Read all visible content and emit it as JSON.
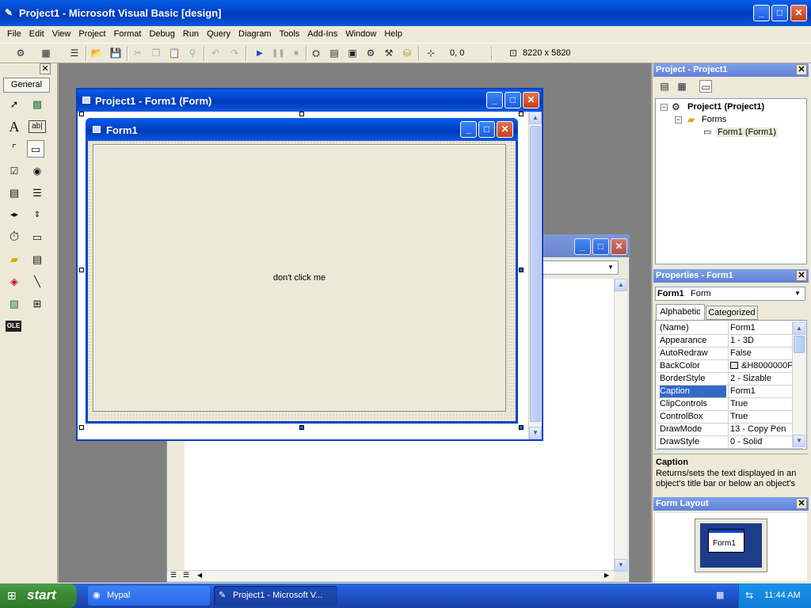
{
  "app": {
    "title": "Project1 - Microsoft Visual Basic [design]"
  },
  "menu": [
    "File",
    "Edit",
    "View",
    "Project",
    "Format",
    "Debug",
    "Run",
    "Query",
    "Diagram",
    "Tools",
    "Add-Ins",
    "Window",
    "Help"
  ],
  "toolbar": {
    "position": "0, 0",
    "size": "8220 x 5820",
    "icons": [
      "add-project-icon",
      "add-form-icon",
      "menu-editor-icon",
      "open-icon",
      "save-icon",
      "cut-icon",
      "copy-icon",
      "paste-icon",
      "find-icon",
      "undo-icon",
      "redo-icon",
      "start-icon",
      "break-icon",
      "end-icon",
      "project-explorer-icon",
      "properties-icon",
      "form-layout-icon",
      "object-browser-icon",
      "toolbox-icon",
      "data-view-icon",
      "component-icon"
    ]
  },
  "toolbox": {
    "tab": "General",
    "tools": [
      "pointer-icon",
      "picturebox-icon",
      "label-icon",
      "textbox-icon",
      "frame-icon",
      "commandbutton-icon",
      "checkbox-icon",
      "optionbutton-icon",
      "combobox-icon",
      "listbox-icon",
      "hscrollbar-icon",
      "vscrollbar-icon",
      "timer-icon",
      "drivelistbox-icon",
      "dirlistbox-icon",
      "filelistbox-icon",
      "shape-icon",
      "line-icon",
      "image-icon",
      "data-icon",
      "ole-icon"
    ]
  },
  "form_designer": {
    "window_title": "Project1 - Form1 (Form)",
    "form_caption": "Form1",
    "button_caption": "don't click me"
  },
  "project_explorer": {
    "title": "Project - Project1",
    "root": "Project1 (Project1)",
    "folder": "Forms",
    "item": "Form1 (Form1)"
  },
  "properties": {
    "title": "Properties - Form1",
    "object_name": "Form1",
    "object_type": "Form",
    "tabs": [
      "Alphabetic",
      "Categorized"
    ],
    "rows": [
      {
        "name": "(Name)",
        "value": "Form1"
      },
      {
        "name": "Appearance",
        "value": "1 - 3D"
      },
      {
        "name": "AutoRedraw",
        "value": "False"
      },
      {
        "name": "BackColor",
        "value": "&H8000000F"
      },
      {
        "name": "BorderStyle",
        "value": "2 - Sizable"
      },
      {
        "name": "Caption",
        "value": "Form1"
      },
      {
        "name": "ClipControls",
        "value": "True"
      },
      {
        "name": "ControlBox",
        "value": "True"
      },
      {
        "name": "DrawMode",
        "value": "13 - Copy Pen"
      },
      {
        "name": "DrawStyle",
        "value": "0 - Solid"
      }
    ],
    "desc_title": "Caption",
    "desc_text": "Returns/sets the text displayed in an object's title bar or below an object's"
  },
  "form_layout": {
    "title": "Form Layout",
    "preview_label": "Form1"
  },
  "taskbar": {
    "start_label": "start",
    "tasks": [
      "Mypal",
      "Project1 - Microsoft V..."
    ],
    "clock": "11:44 AM"
  },
  "colors": {
    "xp_blue": "#0042c8",
    "selection": "#316ac5",
    "form_face": "#ece9d8",
    "mdi_background": "#808080"
  }
}
